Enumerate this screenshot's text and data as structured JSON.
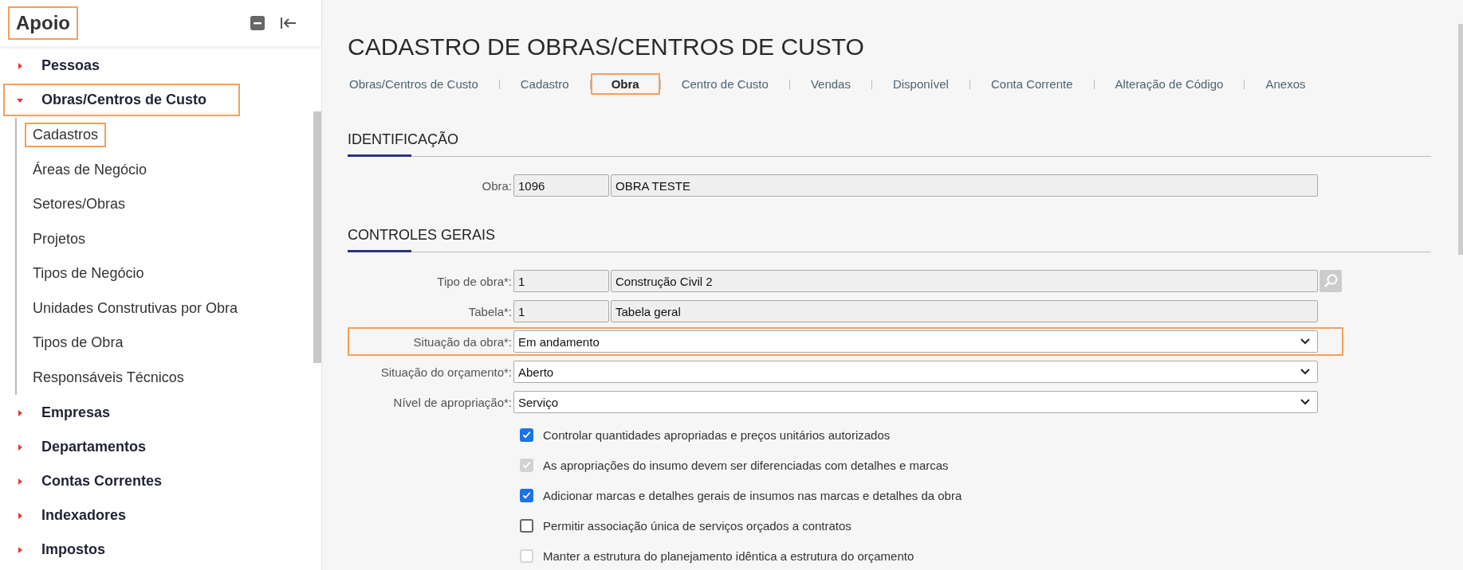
{
  "sidebar": {
    "title": "Apoio",
    "title_highlighted": true,
    "items": [
      {
        "label": "Pessoas",
        "expanded": false,
        "highlighted": false
      },
      {
        "label": "Obras/Centros de Custo",
        "expanded": true,
        "highlighted": true,
        "children": [
          {
            "label": "Cadastros",
            "highlighted": true
          },
          {
            "label": "Áreas de Negócio",
            "highlighted": false
          },
          {
            "label": "Setores/Obras",
            "highlighted": false
          },
          {
            "label": "Projetos",
            "highlighted": false
          },
          {
            "label": "Tipos de Negócio",
            "highlighted": false
          },
          {
            "label": "Unidades Construtivas por Obra",
            "highlighted": false
          },
          {
            "label": "Tipos de Obra",
            "highlighted": false
          },
          {
            "label": "Responsáveis Técnicos",
            "highlighted": false
          }
        ]
      },
      {
        "label": "Empresas",
        "expanded": false,
        "highlighted": false
      },
      {
        "label": "Departamentos",
        "expanded": false,
        "highlighted": false
      },
      {
        "label": "Contas Correntes",
        "expanded": false,
        "highlighted": false
      },
      {
        "label": "Indexadores",
        "expanded": false,
        "highlighted": false
      },
      {
        "label": "Impostos",
        "expanded": false,
        "highlighted": false
      }
    ]
  },
  "page": {
    "title": "CADASTRO DE OBRAS/CENTROS DE CUSTO",
    "tabs": [
      {
        "label": "Obras/Centros de Custo",
        "selected": false
      },
      {
        "label": "Cadastro",
        "selected": false
      },
      {
        "label": "Obra",
        "selected": true
      },
      {
        "label": "Centro de Custo",
        "selected": false
      },
      {
        "label": "Vendas",
        "selected": false
      },
      {
        "label": "Disponível",
        "selected": false
      },
      {
        "label": "Conta Corrente",
        "selected": false
      },
      {
        "label": "Alteração de Código",
        "selected": false
      },
      {
        "label": "Anexos",
        "selected": false
      }
    ],
    "sections": [
      {
        "heading": "IDENTIFICAÇÃO",
        "fields": [
          {
            "kind": "lookup",
            "label": "Obra:",
            "code": "1096",
            "value": "OBRA TESTE",
            "highlighted": false
          }
        ]
      },
      {
        "heading": "CONTROLES GERAIS",
        "fields": [
          {
            "kind": "lookup",
            "label": "Tipo de obra*:",
            "code": "1",
            "value": "Construção Civil 2",
            "search": true,
            "highlighted": false
          },
          {
            "kind": "lookup",
            "label": "Tabela*:",
            "code": "1",
            "value": "Tabela geral",
            "highlighted": false
          },
          {
            "kind": "select",
            "label": "Situação da obra*:",
            "value": "Em andamento",
            "highlighted": true
          },
          {
            "kind": "select",
            "label": "Situação do orçamento*:",
            "value": "Aberto",
            "highlighted": false
          },
          {
            "kind": "select",
            "label": "Nível de apropriação*:",
            "value": "Serviço",
            "highlighted": false
          }
        ],
        "checkboxes": [
          {
            "label": "Controlar quantidades apropriadas e preços unitários autorizados",
            "checked": true,
            "disabled": false
          },
          {
            "label": "As apropriações do insumo devem ser diferenciadas com detalhes e marcas",
            "checked": true,
            "disabled": true
          },
          {
            "label": "Adicionar marcas e detalhes gerais de insumos nas marcas e detalhes da obra",
            "checked": true,
            "disabled": false
          },
          {
            "label": "Permitir associação única de serviços orçados a contratos",
            "checked": false,
            "disabled": false
          },
          {
            "label": "Manter a estrutura do planejamento idêntica a estrutura do orçamento",
            "checked": false,
            "disabled": true
          }
        ]
      }
    ]
  }
}
